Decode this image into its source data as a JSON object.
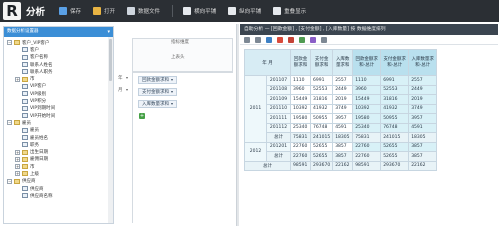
{
  "toolbar": {
    "logo": "R",
    "title": "分析",
    "buttons": [
      {
        "label": "保存",
        "icon": "save-icon",
        "color": "#5aa0e6"
      },
      {
        "label": "打开",
        "icon": "open-folder-icon",
        "color": "#e8b443"
      },
      {
        "label": "数据文件",
        "icon": "data-file-icon",
        "color": "#cfd6de"
      },
      {
        "label": "横向平铺",
        "icon": "horizontal-tile-icon",
        "color": "#e6e9ed"
      },
      {
        "label": "纵向平铺",
        "icon": "vertical-tile-icon",
        "color": "#e6e9ed"
      },
      {
        "label": "重叠显示",
        "icon": "overlap-icon",
        "color": "#e6e9ed"
      }
    ]
  },
  "left_panel": {
    "title": "数据分析设置器",
    "tree": [
      {
        "label": "客户_VIP客户",
        "depth": 0,
        "type": "folder",
        "expander": "−"
      },
      {
        "label": "客户",
        "depth": 1,
        "type": "field"
      },
      {
        "label": "客户名称",
        "depth": 1,
        "type": "field"
      },
      {
        "label": "联系人姓名",
        "depth": 1,
        "type": "field"
      },
      {
        "label": "联系人职务",
        "depth": 1,
        "type": "field"
      },
      {
        "label": "市",
        "depth": 1,
        "type": "folder",
        "expander": "+"
      },
      {
        "label": "VIP客户",
        "depth": 1,
        "type": "field"
      },
      {
        "label": "VIP级别",
        "depth": 1,
        "type": "field"
      },
      {
        "label": "VIP积分",
        "depth": 1,
        "type": "field"
      },
      {
        "label": "VIP到期时间",
        "depth": 1,
        "type": "field"
      },
      {
        "label": "VIP开始时间",
        "depth": 1,
        "type": "field"
      },
      {
        "label": "雇员",
        "depth": 0,
        "type": "folder",
        "expander": "−"
      },
      {
        "label": "雇员",
        "depth": 1,
        "type": "field"
      },
      {
        "label": "雇员姓名",
        "depth": 1,
        "type": "field"
      },
      {
        "label": "职务",
        "depth": 1,
        "type": "field"
      },
      {
        "label": "出生日期",
        "depth": 1,
        "type": "folder",
        "expander": "+"
      },
      {
        "label": "雇佣日期",
        "depth": 1,
        "type": "folder",
        "expander": "+"
      },
      {
        "label": "市",
        "depth": 1,
        "type": "folder",
        "expander": "+"
      },
      {
        "label": "上级",
        "depth": 1,
        "type": "folder",
        "expander": "+"
      },
      {
        "label": "供应商",
        "depth": 0,
        "type": "folder",
        "expander": "−"
      },
      {
        "label": "供应商",
        "depth": 1,
        "type": "field"
      },
      {
        "label": "供应商名称",
        "depth": 1,
        "type": "field"
      }
    ]
  },
  "zones": {
    "top_placeholder": "上表头",
    "row_fields": [
      "年",
      "月"
    ],
    "measure_header": "指标维度",
    "measures": [
      "回款金额求和",
      "支付金额求和",
      "入库数量求和"
    ],
    "add": "+"
  },
  "right_panel": {
    "title": "自助分析 — [回款金额] , [支付金额] , [入库数量] 按 数据维度排列",
    "tool_colors": [
      "#7d8894",
      "#7d8894",
      "#3d80c4",
      "#d94a3b",
      "#c44337",
      "#4f9b52",
      "#8a5ec7",
      "#7d8894"
    ],
    "table": {
      "corner": "年  月",
      "headers": [
        "回款金额求和",
        "支付金额求和",
        "入库数量求和",
        "回款金额求和-总计",
        "支付金额求和-总计",
        "入库数量求和-总计"
      ],
      "groups": [
        {
          "year": "2011",
          "rows": [
            {
              "month": "201107",
              "values": [
                "1110",
                "6991",
                "2557",
                "1110",
                "6991",
                "2557"
              ]
            },
            {
              "month": "201108",
              "values": [
                "3960",
                "52553",
                "2449",
                "3960",
                "52553",
                "2449"
              ]
            },
            {
              "month": "201109",
              "values": [
                "15449",
                "31816",
                "2019",
                "15449",
                "31816",
                "2019"
              ]
            },
            {
              "month": "201110",
              "values": [
                "10392",
                "41932",
                "3749",
                "10392",
                "41932",
                "3749"
              ]
            },
            {
              "month": "201111",
              "values": [
                "19580",
                "50955",
                "3957",
                "19580",
                "50955",
                "3957"
              ]
            },
            {
              "month": "201112",
              "values": [
                "25340",
                "76748",
                "4591",
                "25340",
                "76748",
                "4591"
              ]
            }
          ],
          "total": {
            "label": "总计",
            "values": [
              "75831",
              "241015",
              "18305",
              "75831",
              "241015",
              "18305"
            ]
          }
        },
        {
          "year": "2012",
          "rows": [
            {
              "month": "201201",
              "values": [
                "22760",
                "52655",
                "3857",
                "22760",
                "52655",
                "3857"
              ]
            }
          ],
          "total": {
            "label": "总计",
            "values": [
              "22760",
              "52655",
              "3857",
              "22760",
              "52655",
              "3857"
            ]
          }
        }
      ],
      "grand_total": {
        "label": "总计",
        "values": [
          "98591",
          "293670",
          "22162",
          "98591",
          "293670",
          "22162"
        ]
      }
    }
  }
}
